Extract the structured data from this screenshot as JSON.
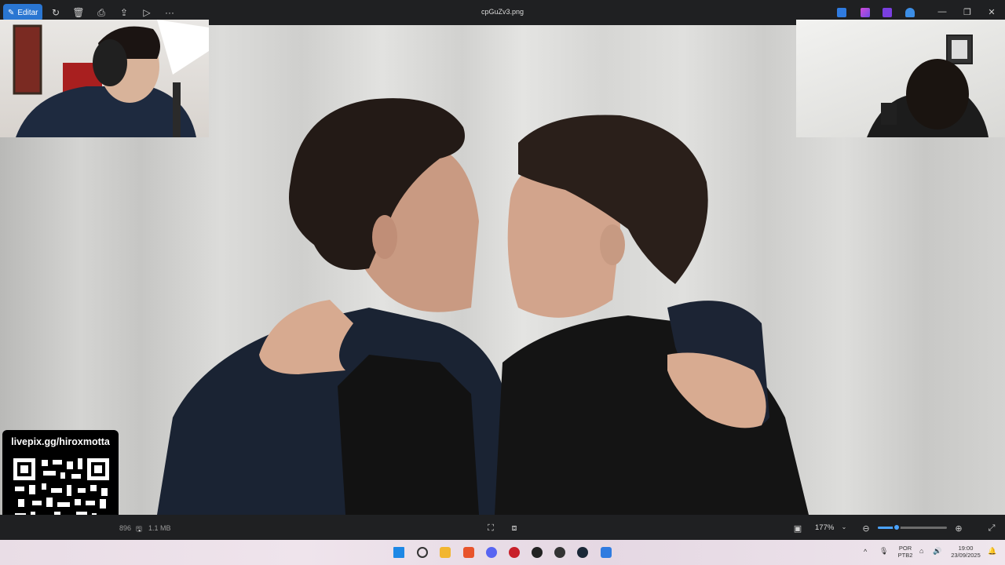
{
  "titlebar": {
    "edit_label": "Editar",
    "filename": "cpGuZv3.png"
  },
  "overlay": {
    "donation_link": "livepix.gg/hiroxmotta"
  },
  "statusbar": {
    "dimensions_partial": "896",
    "file_size": "1.1 MB",
    "zoom_level": "177%",
    "zoom_fraction": 0.27
  },
  "tray": {
    "lang_line1": "POR",
    "lang_line2": "PTB2",
    "time": "19:00",
    "date": "23/09/2025"
  },
  "icons": {
    "edit": "pencil-icon",
    "rotate": "rotate-icon",
    "delete": "trash-icon",
    "print": "printer-icon",
    "share": "share-icon",
    "slideshow": "play-icon",
    "more": "more-icon",
    "minimize": "minimize-icon",
    "maximize": "maximize-icon",
    "close": "close-icon"
  },
  "colors": {
    "accent": "#2a76d2",
    "slider": "#4aa3ff"
  }
}
